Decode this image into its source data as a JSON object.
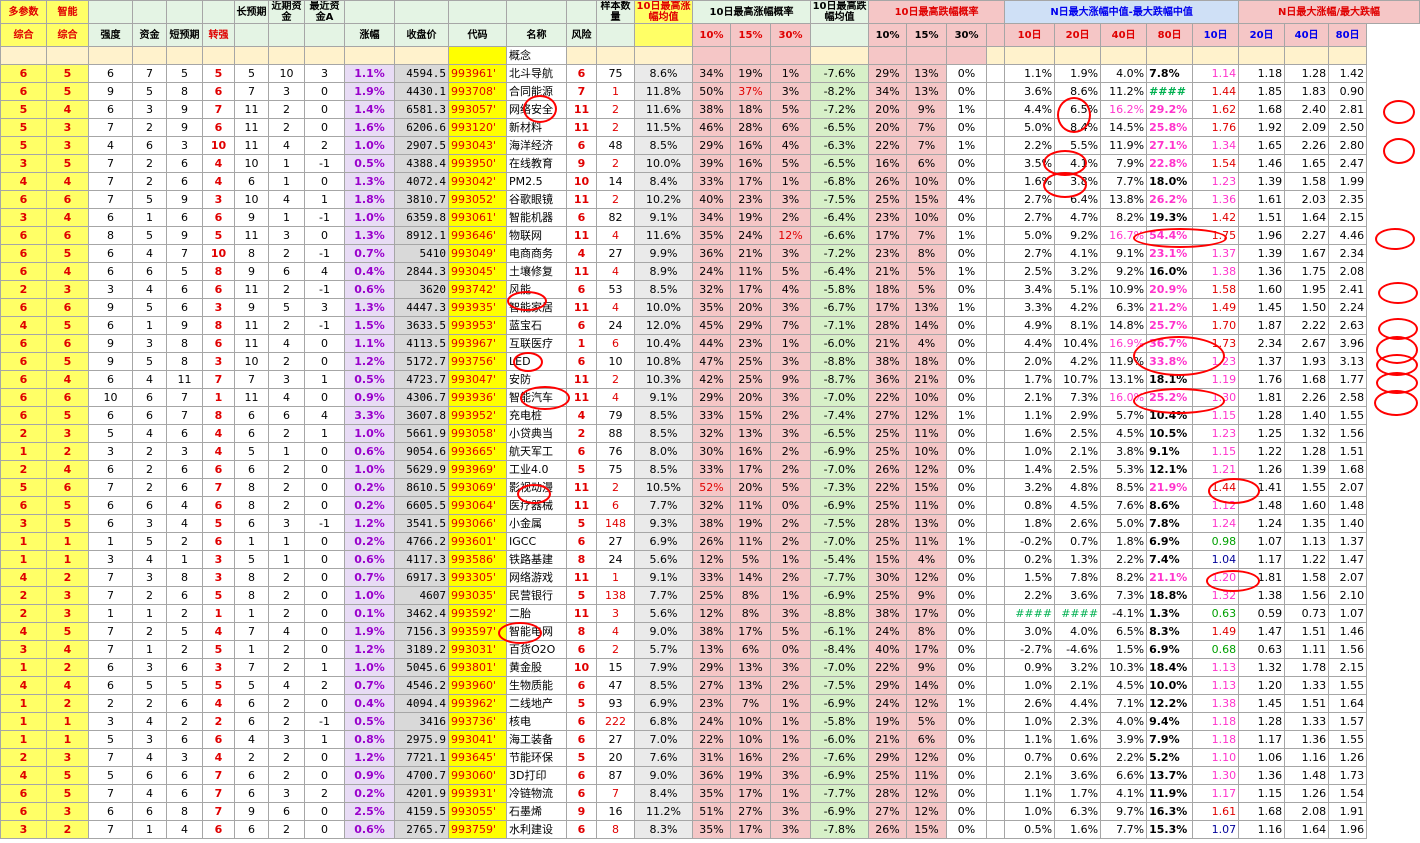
{
  "header1": [
    "多参数",
    "智能",
    "",
    "",
    "",
    "",
    "长预期",
    "近期资金",
    "最近资金A",
    "",
    "",
    "",
    "",
    "",
    "样本数量",
    "10日最高涨幅均值",
    "10日最高涨幅概率",
    "",
    "",
    "",
    "10日最高跌幅均值",
    "10日最高跌幅概率",
    "",
    "",
    "",
    "N日最大涨幅中值-最大跌幅中值",
    "",
    "",
    "",
    "N日最大涨幅/最大跌幅",
    "",
    "",
    ""
  ],
  "header2": [
    "综合",
    "综合",
    "强度",
    "资金",
    "短预期",
    "转强",
    "",
    "",
    "",
    "涨幅",
    "收盘价",
    "代码",
    "名称",
    "风险",
    "",
    "",
    "10%",
    "15%",
    "30%",
    "",
    "",
    "10%",
    "15%",
    "30%",
    "",
    "10日",
    "20日",
    "40日",
    "80日",
    "",
    "10日",
    "20日",
    "40日",
    "80日"
  ],
  "concept_label": "概念",
  "rows": [
    [
      "6",
      "5",
      "6",
      "7",
      "5",
      "5",
      "5",
      "10",
      "3",
      "1.1%",
      "4594.5",
      "993961'",
      "北斗导航",
      "6",
      "75",
      "8.6%",
      "34%",
      "19%",
      "1%",
      "-7.6%",
      "29%",
      "13%",
      "0%",
      "1.1%",
      "1.9%",
      "4.0%",
      "7.8%",
      "1.14",
      "1.18",
      "1.28",
      "1.42"
    ],
    [
      "6",
      "5",
      "9",
      "5",
      "8",
      "6",
      "7",
      "3",
      "0",
      "1.9%",
      "4430.1",
      "993708'",
      "合同能源",
      "7",
      "1",
      "11.8%",
      "50%",
      "37%",
      "3%",
      "-8.2%",
      "34%",
      "13%",
      "0%",
      "3.6%",
      "8.6%",
      "11.2%",
      "####",
      "1.44",
      "1.85",
      "1.83",
      "0.90"
    ],
    [
      "5",
      "4",
      "6",
      "3",
      "9",
      "7",
      "11",
      "2",
      "0",
      "1.4%",
      "6581.3",
      "993057'",
      "网络安全",
      "11",
      "2",
      "11.6%",
      "38%",
      "18%",
      "5%",
      "-7.2%",
      "20%",
      "9%",
      "1%",
      "4.4%",
      "6.5%",
      "16.2%",
      "29.2%",
      "1.62",
      "1.68",
      "2.40",
      "2.81"
    ],
    [
      "5",
      "3",
      "7",
      "2",
      "9",
      "6",
      "11",
      "2",
      "0",
      "1.6%",
      "6206.6",
      "993120'",
      "新材料",
      "11",
      "2",
      "11.5%",
      "46%",
      "28%",
      "6%",
      "-6.5%",
      "20%",
      "7%",
      "0%",
      "5.0%",
      "8.4%",
      "14.5%",
      "25.8%",
      "1.76",
      "1.92",
      "2.09",
      "2.50"
    ],
    [
      "5",
      "3",
      "4",
      "6",
      "3",
      "10",
      "11",
      "4",
      "2",
      "1.0%",
      "2907.5",
      "993043'",
      "海洋经济",
      "6",
      "48",
      "8.5%",
      "29%",
      "16%",
      "4%",
      "-6.3%",
      "22%",
      "7%",
      "1%",
      "2.2%",
      "5.5%",
      "11.9%",
      "27.1%",
      "1.34",
      "1.65",
      "2.26",
      "2.80"
    ],
    [
      "3",
      "5",
      "7",
      "2",
      "6",
      "4",
      "10",
      "1",
      "-1",
      "0.5%",
      "4388.4",
      "993950'",
      "在线教育",
      "9",
      "2",
      "10.0%",
      "39%",
      "16%",
      "5%",
      "-6.5%",
      "16%",
      "6%",
      "0%",
      "3.5%",
      "4.1%",
      "7.9%",
      "22.8%",
      "1.54",
      "1.46",
      "1.65",
      "2.47"
    ],
    [
      "4",
      "4",
      "7",
      "2",
      "6",
      "4",
      "6",
      "1",
      "0",
      "1.3%",
      "4072.4",
      "993042'",
      "PM2.5",
      "10",
      "14",
      "8.4%",
      "33%",
      "17%",
      "1%",
      "-6.8%",
      "26%",
      "10%",
      "0%",
      "1.6%",
      "3.8%",
      "7.7%",
      "18.0%",
      "1.23",
      "1.39",
      "1.58",
      "1.99"
    ],
    [
      "6",
      "6",
      "7",
      "5",
      "9",
      "3",
      "10",
      "4",
      "1",
      "1.8%",
      "3810.7",
      "993052'",
      "谷歌眼镜",
      "11",
      "2",
      "10.2%",
      "40%",
      "23%",
      "3%",
      "-7.5%",
      "25%",
      "15%",
      "4%",
      "2.7%",
      "6.4%",
      "13.8%",
      "26.2%",
      "1.36",
      "1.61",
      "2.03",
      "2.35"
    ],
    [
      "3",
      "4",
      "6",
      "1",
      "6",
      "6",
      "9",
      "1",
      "-1",
      "1.0%",
      "6359.8",
      "993061'",
      "智能机器",
      "6",
      "82",
      "9.1%",
      "34%",
      "19%",
      "2%",
      "-6.4%",
      "23%",
      "10%",
      "0%",
      "2.7%",
      "4.7%",
      "8.2%",
      "19.3%",
      "1.42",
      "1.51",
      "1.64",
      "2.15"
    ],
    [
      "6",
      "6",
      "8",
      "5",
      "9",
      "5",
      "11",
      "3",
      "0",
      "1.3%",
      "8912.1",
      "993646'",
      "物联网",
      "11",
      "4",
      "11.6%",
      "35%",
      "24%",
      "12%",
      "-6.6%",
      "17%",
      "7%",
      "1%",
      "5.0%",
      "9.2%",
      "16.7%",
      "54.4%",
      "1.75",
      "1.96",
      "2.27",
      "4.46"
    ],
    [
      "6",
      "5",
      "6",
      "4",
      "7",
      "10",
      "8",
      "2",
      "-1",
      "0.7%",
      "5410",
      "993049'",
      "电商商务",
      "4",
      "27",
      "9.9%",
      "36%",
      "21%",
      "3%",
      "-7.2%",
      "23%",
      "8%",
      "0%",
      "2.7%",
      "4.1%",
      "9.1%",
      "23.1%",
      "1.37",
      "1.39",
      "1.67",
      "2.34"
    ],
    [
      "6",
      "4",
      "6",
      "6",
      "5",
      "8",
      "9",
      "6",
      "4",
      "0.4%",
      "2844.3",
      "993045'",
      "土壤修复",
      "11",
      "4",
      "8.9%",
      "24%",
      "11%",
      "5%",
      "-6.4%",
      "21%",
      "5%",
      "1%",
      "2.5%",
      "3.2%",
      "9.2%",
      "16.0%",
      "1.38",
      "1.36",
      "1.75",
      "2.08"
    ],
    [
      "2",
      "3",
      "3",
      "4",
      "6",
      "6",
      "11",
      "2",
      "-1",
      "0.6%",
      "3620",
      "993742'",
      "风能",
      "6",
      "53",
      "8.5%",
      "32%",
      "17%",
      "4%",
      "-5.8%",
      "18%",
      "5%",
      "0%",
      "3.4%",
      "5.1%",
      "10.9%",
      "20.9%",
      "1.58",
      "1.60",
      "1.95",
      "2.41"
    ],
    [
      "6",
      "6",
      "9",
      "5",
      "6",
      "3",
      "9",
      "5",
      "3",
      "1.3%",
      "4447.3",
      "993935'",
      "智能家居",
      "11",
      "4",
      "10.0%",
      "35%",
      "20%",
      "3%",
      "-6.7%",
      "17%",
      "13%",
      "1%",
      "3.3%",
      "4.2%",
      "6.3%",
      "21.2%",
      "1.49",
      "1.45",
      "1.50",
      "2.24"
    ],
    [
      "4",
      "5",
      "6",
      "1",
      "9",
      "8",
      "11",
      "2",
      "-1",
      "1.5%",
      "3633.5",
      "993953'",
      "蓝宝石",
      "6",
      "24",
      "12.0%",
      "45%",
      "29%",
      "7%",
      "-7.1%",
      "28%",
      "14%",
      "0%",
      "4.9%",
      "8.1%",
      "14.8%",
      "25.7%",
      "1.70",
      "1.87",
      "2.22",
      "2.63"
    ],
    [
      "6",
      "6",
      "9",
      "3",
      "8",
      "6",
      "11",
      "4",
      "0",
      "1.1%",
      "4113.5",
      "993967'",
      "互联医疗",
      "1",
      "6",
      "10.4%",
      "44%",
      "23%",
      "1%",
      "-6.0%",
      "21%",
      "4%",
      "0%",
      "4.4%",
      "10.4%",
      "16.9%",
      "36.7%",
      "1.73",
      "2.34",
      "2.67",
      "3.96"
    ],
    [
      "6",
      "5",
      "9",
      "5",
      "8",
      "3",
      "10",
      "2",
      "0",
      "1.2%",
      "5172.7",
      "993756'",
      "LED",
      "6",
      "10",
      "10.8%",
      "47%",
      "25%",
      "3%",
      "-8.8%",
      "38%",
      "18%",
      "0%",
      "2.0%",
      "4.2%",
      "11.9%",
      "33.8%",
      "1.23",
      "1.37",
      "1.93",
      "3.13"
    ],
    [
      "6",
      "4",
      "6",
      "4",
      "11",
      "7",
      "7",
      "3",
      "1",
      "0.5%",
      "4723.7",
      "993047'",
      "安防",
      "11",
      "2",
      "10.3%",
      "42%",
      "25%",
      "9%",
      "-8.7%",
      "36%",
      "21%",
      "0%",
      "1.7%",
      "10.7%",
      "13.1%",
      "18.1%",
      "1.19",
      "1.76",
      "1.68",
      "1.77"
    ],
    [
      "6",
      "6",
      "10",
      "6",
      "7",
      "1",
      "11",
      "4",
      "0",
      "0.9%",
      "4306.7",
      "993936'",
      "智能汽车",
      "11",
      "4",
      "9.1%",
      "29%",
      "20%",
      "3%",
      "-7.0%",
      "22%",
      "10%",
      "0%",
      "2.1%",
      "7.3%",
      "16.0%",
      "25.2%",
      "1.30",
      "1.81",
      "2.26",
      "2.58"
    ],
    [
      "6",
      "5",
      "6",
      "6",
      "7",
      "8",
      "6",
      "6",
      "4",
      "3.3%",
      "3607.8",
      "993952'",
      "充电桩",
      "4",
      "79",
      "8.5%",
      "33%",
      "15%",
      "2%",
      "-7.4%",
      "27%",
      "12%",
      "1%",
      "1.1%",
      "2.9%",
      "5.7%",
      "10.4%",
      "1.15",
      "1.28",
      "1.40",
      "1.55"
    ],
    [
      "2",
      "3",
      "5",
      "4",
      "6",
      "4",
      "6",
      "2",
      "1",
      "1.0%",
      "5661.9",
      "993058'",
      "小贷典当",
      "2",
      "88",
      "8.5%",
      "32%",
      "13%",
      "3%",
      "-6.5%",
      "25%",
      "11%",
      "0%",
      "1.6%",
      "2.5%",
      "4.5%",
      "10.5%",
      "1.23",
      "1.25",
      "1.32",
      "1.56"
    ],
    [
      "1",
      "2",
      "3",
      "2",
      "3",
      "4",
      "5",
      "1",
      "0",
      "0.6%",
      "9054.6",
      "993665'",
      "航天军工",
      "6",
      "76",
      "8.0%",
      "30%",
      "16%",
      "2%",
      "-6.9%",
      "25%",
      "10%",
      "0%",
      "1.0%",
      "2.1%",
      "3.8%",
      "9.1%",
      "1.15",
      "1.22",
      "1.28",
      "1.51"
    ],
    [
      "2",
      "4",
      "6",
      "2",
      "6",
      "6",
      "6",
      "2",
      "0",
      "1.0%",
      "5629.9",
      "993969'",
      "工业4.0",
      "5",
      "75",
      "8.5%",
      "33%",
      "17%",
      "2%",
      "-7.0%",
      "26%",
      "12%",
      "0%",
      "1.4%",
      "2.5%",
      "5.3%",
      "12.1%",
      "1.21",
      "1.26",
      "1.39",
      "1.68"
    ],
    [
      "5",
      "6",
      "7",
      "2",
      "6",
      "7",
      "8",
      "2",
      "0",
      "0.2%",
      "8610.5",
      "993069'",
      "影视动漫",
      "11",
      "2",
      "10.5%",
      "52%",
      "20%",
      "5%",
      "-7.3%",
      "22%",
      "15%",
      "0%",
      "3.2%",
      "4.8%",
      "8.5%",
      "21.9%",
      "1.44",
      "1.41",
      "1.55",
      "2.07"
    ],
    [
      "6",
      "5",
      "6",
      "6",
      "4",
      "6",
      "8",
      "2",
      "0",
      "0.2%",
      "6605.5",
      "993064'",
      "医疗器械",
      "11",
      "6",
      "7.7%",
      "32%",
      "11%",
      "0%",
      "-6.9%",
      "25%",
      "11%",
      "0%",
      "0.8%",
      "4.5%",
      "7.6%",
      "8.6%",
      "1.12",
      "1.48",
      "1.60",
      "1.48"
    ],
    [
      "3",
      "5",
      "6",
      "3",
      "4",
      "5",
      "6",
      "3",
      "-1",
      "1.2%",
      "3541.5",
      "993066'",
      "小金属",
      "5",
      "148",
      "9.3%",
      "38%",
      "19%",
      "2%",
      "-7.5%",
      "28%",
      "13%",
      "0%",
      "1.8%",
      "2.6%",
      "5.0%",
      "7.8%",
      "1.24",
      "1.24",
      "1.35",
      "1.40"
    ],
    [
      "1",
      "1",
      "1",
      "5",
      "2",
      "6",
      "1",
      "1",
      "0",
      "0.2%",
      "4766.2",
      "993601'",
      "IGCC",
      "6",
      "27",
      "6.9%",
      "26%",
      "11%",
      "2%",
      "-7.0%",
      "25%",
      "11%",
      "1%",
      "-0.2%",
      "0.7%",
      "1.8%",
      "6.9%",
      "0.98",
      "1.07",
      "1.13",
      "1.37"
    ],
    [
      "1",
      "1",
      "3",
      "4",
      "1",
      "3",
      "5",
      "1",
      "0",
      "0.6%",
      "4117.3",
      "993586'",
      "铁路基建",
      "8",
      "24",
      "5.6%",
      "12%",
      "5%",
      "1%",
      "-5.4%",
      "15%",
      "4%",
      "0%",
      "0.2%",
      "1.3%",
      "2.2%",
      "7.4%",
      "1.04",
      "1.17",
      "1.22",
      "1.47"
    ],
    [
      "4",
      "2",
      "7",
      "3",
      "8",
      "3",
      "8",
      "2",
      "0",
      "0.7%",
      "6917.3",
      "993305'",
      "网络游戏",
      "11",
      "1",
      "9.1%",
      "33%",
      "14%",
      "2%",
      "-7.7%",
      "30%",
      "12%",
      "0%",
      "1.5%",
      "7.8%",
      "8.2%",
      "21.1%",
      "1.20",
      "1.81",
      "1.58",
      "2.07"
    ],
    [
      "2",
      "3",
      "7",
      "2",
      "6",
      "5",
      "8",
      "2",
      "0",
      "1.0%",
      "4607",
      "993035'",
      "民营银行",
      "5",
      "138",
      "7.7%",
      "25%",
      "8%",
      "1%",
      "-6.9%",
      "25%",
      "9%",
      "0%",
      "2.2%",
      "3.6%",
      "7.3%",
      "18.8%",
      "1.32",
      "1.38",
      "1.56",
      "2.10"
    ],
    [
      "2",
      "3",
      "1",
      "1",
      "2",
      "1",
      "1",
      "2",
      "0",
      "0.1%",
      "3462.4",
      "993592'",
      "二胎",
      "11",
      "3",
      "5.6%",
      "12%",
      "8%",
      "3%",
      "-8.8%",
      "38%",
      "17%",
      "0%",
      "####",
      "####",
      "-4.1%",
      "1.3%",
      "0.63",
      "0.59",
      "0.73",
      "1.07"
    ],
    [
      "4",
      "5",
      "7",
      "2",
      "5",
      "4",
      "7",
      "4",
      "0",
      "1.9%",
      "7156.3",
      "993597'",
      "智能电网",
      "8",
      "4",
      "9.0%",
      "38%",
      "17%",
      "5%",
      "-6.1%",
      "24%",
      "8%",
      "0%",
      "3.0%",
      "4.0%",
      "6.5%",
      "8.3%",
      "1.49",
      "1.47",
      "1.51",
      "1.46"
    ],
    [
      "3",
      "4",
      "7",
      "1",
      "2",
      "5",
      "1",
      "2",
      "0",
      "1.2%",
      "3189.2",
      "993031'",
      "百货O2O",
      "6",
      "2",
      "5.7%",
      "13%",
      "6%",
      "0%",
      "-8.4%",
      "40%",
      "17%",
      "0%",
      "-2.7%",
      "-4.6%",
      "1.5%",
      "6.9%",
      "0.68",
      "0.63",
      "1.11",
      "1.56"
    ],
    [
      "1",
      "2",
      "6",
      "3",
      "6",
      "3",
      "7",
      "2",
      "1",
      "1.0%",
      "5045.6",
      "993801'",
      "黄金股",
      "10",
      "15",
      "7.9%",
      "29%",
      "13%",
      "3%",
      "-7.0%",
      "22%",
      "9%",
      "0%",
      "0.9%",
      "3.2%",
      "10.3%",
      "18.4%",
      "1.13",
      "1.32",
      "1.78",
      "2.15"
    ],
    [
      "4",
      "4",
      "6",
      "5",
      "5",
      "5",
      "5",
      "4",
      "2",
      "0.7%",
      "4546.2",
      "993960'",
      "生物质能",
      "6",
      "47",
      "8.5%",
      "27%",
      "13%",
      "2%",
      "-7.5%",
      "29%",
      "14%",
      "0%",
      "1.0%",
      "2.1%",
      "4.5%",
      "10.0%",
      "1.13",
      "1.20",
      "1.33",
      "1.55"
    ],
    [
      "1",
      "2",
      "2",
      "2",
      "6",
      "4",
      "6",
      "2",
      "0",
      "0.4%",
      "4094.4",
      "993962'",
      "二线地产",
      "5",
      "93",
      "6.9%",
      "23%",
      "7%",
      "1%",
      "-6.9%",
      "24%",
      "12%",
      "1%",
      "2.6%",
      "4.4%",
      "7.1%",
      "12.2%",
      "1.38",
      "1.45",
      "1.51",
      "1.64"
    ],
    [
      "1",
      "1",
      "3",
      "4",
      "2",
      "2",
      "6",
      "2",
      "-1",
      "0.5%",
      "3416",
      "993736'",
      "核电",
      "6",
      "222",
      "6.8%",
      "24%",
      "10%",
      "1%",
      "-5.8%",
      "19%",
      "5%",
      "0%",
      "1.0%",
      "2.3%",
      "4.0%",
      "9.4%",
      "1.18",
      "1.28",
      "1.33",
      "1.57"
    ],
    [
      "1",
      "1",
      "5",
      "3",
      "6",
      "6",
      "4",
      "3",
      "1",
      "0.8%",
      "2975.9",
      "993041'",
      "海工装备",
      "6",
      "27",
      "7.0%",
      "22%",
      "10%",
      "1%",
      "-6.0%",
      "21%",
      "6%",
      "0%",
      "1.1%",
      "1.6%",
      "3.9%",
      "7.9%",
      "1.18",
      "1.17",
      "1.36",
      "1.55"
    ],
    [
      "2",
      "3",
      "7",
      "4",
      "3",
      "4",
      "2",
      "2",
      "0",
      "1.2%",
      "7721.1",
      "993645'",
      "节能环保",
      "5",
      "20",
      "7.6%",
      "31%",
      "16%",
      "2%",
      "-7.6%",
      "29%",
      "12%",
      "0%",
      "0.7%",
      "0.6%",
      "2.2%",
      "5.2%",
      "1.10",
      "1.06",
      "1.16",
      "1.26"
    ],
    [
      "4",
      "5",
      "5",
      "6",
      "6",
      "7",
      "6",
      "2",
      "0",
      "0.9%",
      "4700.7",
      "993060'",
      "3D打印",
      "6",
      "87",
      "9.0%",
      "36%",
      "19%",
      "3%",
      "-6.9%",
      "25%",
      "11%",
      "0%",
      "2.1%",
      "3.6%",
      "6.6%",
      "13.7%",
      "1.30",
      "1.36",
      "1.48",
      "1.73"
    ],
    [
      "6",
      "5",
      "7",
      "4",
      "6",
      "7",
      "6",
      "3",
      "2",
      "0.2%",
      "4201.9",
      "993931'",
      "冷链物流",
      "6",
      "7",
      "8.4%",
      "35%",
      "17%",
      "1%",
      "-7.7%",
      "28%",
      "12%",
      "0%",
      "1.1%",
      "1.7%",
      "4.1%",
      "11.9%",
      "1.17",
      "1.15",
      "1.26",
      "1.54"
    ],
    [
      "6",
      "3",
      "6",
      "6",
      "8",
      "7",
      "9",
      "6",
      "0",
      "2.5%",
      "4159.5",
      "993055'",
      "石墨烯",
      "9",
      "16",
      "11.2%",
      "51%",
      "27%",
      "3%",
      "-6.9%",
      "27%",
      "12%",
      "0%",
      "1.0%",
      "6.3%",
      "9.7%",
      "16.3%",
      "1.61",
      "1.68",
      "2.08",
      "1.91"
    ],
    [
      "3",
      "2",
      "7",
      "1",
      "4",
      "6",
      "6",
      "2",
      "0",
      "0.6%",
      "2765.7",
      "993759'",
      "水利建设",
      "6",
      "8",
      "8.3%",
      "35%",
      "17%",
      "3%",
      "-7.8%",
      "26%",
      "15%",
      "0%",
      "0.5%",
      "1.6%",
      "7.7%",
      "15.3%",
      "1.07",
      "1.16",
      "1.64",
      "1.96"
    ]
  ],
  "rings": [
    [
      1057,
      97,
      34,
      36
    ],
    [
      1383,
      100,
      32,
      24
    ],
    [
      1043,
      150,
      44,
      26
    ],
    [
      1383,
      138,
      32,
      26
    ],
    [
      1043,
      172,
      44,
      26
    ],
    [
      1133,
      228,
      94,
      20
    ],
    [
      1375,
      228,
      40,
      22
    ],
    [
      1378,
      282,
      40,
      22
    ],
    [
      1378,
      318,
      40,
      22
    ],
    [
      1133,
      336,
      92,
      40
    ],
    [
      1376,
      336,
      42,
      28
    ],
    [
      1376,
      354,
      42,
      22
    ],
    [
      1376,
      372,
      42,
      22
    ],
    [
      1133,
      388,
      92,
      26
    ],
    [
      1374,
      390,
      44,
      26
    ],
    [
      1208,
      478,
      52,
      26
    ],
    [
      1206,
      570,
      54,
      22
    ],
    [
      507,
      291,
      40,
      20
    ],
    [
      513,
      352,
      30,
      20
    ],
    [
      520,
      386,
      50,
      24
    ],
    [
      517,
      484,
      34,
      20
    ],
    [
      498,
      622,
      44,
      22
    ],
    [
      523,
      95,
      34,
      28
    ]
  ]
}
